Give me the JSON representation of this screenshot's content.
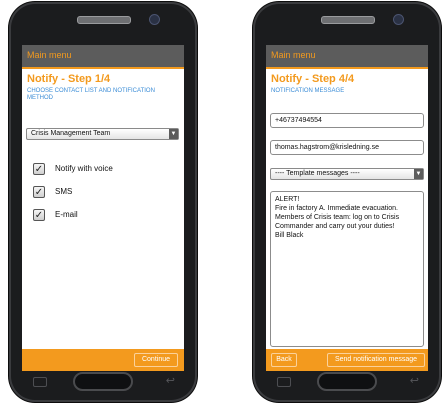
{
  "left_screen": {
    "menu_label": "Main menu",
    "step_title": "Notify - Step 1/4",
    "step_subtitle": "CHOOSE CONTACT LIST AND NOTIFICATION METHOD",
    "contact_list_selected": "Crisis Management Team",
    "options": [
      {
        "label": "Notify with voice",
        "checked": true
      },
      {
        "label": "SMS",
        "checked": true
      },
      {
        "label": "E-mail",
        "checked": true
      }
    ],
    "continue_label": "Continue"
  },
  "right_screen": {
    "menu_label": "Main menu",
    "step_title": "Notify - Step 4/4",
    "step_subtitle": "NOTIFICATION MESSAGE",
    "phone_value": "+46737494554",
    "email_value": "thomas.hagstrom@krisledning.se",
    "template_selected": "---- Template messages ----",
    "message_lines": [
      "ALERT!",
      "Fire in factory A. Immediate evacuation.",
      "Members of Crisis team: log on to Crisis",
      "Commander and carry out your duties!",
      "Bill Black"
    ],
    "back_label": "Back",
    "send_label": "Send notification message"
  },
  "colors": {
    "accent": "#f39a1e",
    "appbar": "#5c5c5c",
    "subtitle_blue": "#3a8cd6",
    "phone_body": "#1b1c1e"
  },
  "icons": {
    "checkbox": "check-mark",
    "dropdown": "triangle-down"
  }
}
